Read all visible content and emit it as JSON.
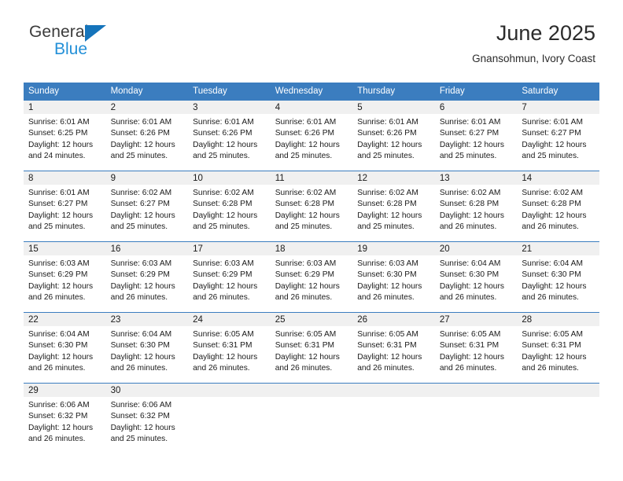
{
  "logo": {
    "primary_text": "General",
    "secondary_text": "Blue",
    "primary_color": "#3b3b3b",
    "secondary_color": "#2390d8",
    "accent_color": "#1574bb"
  },
  "header": {
    "title": "June 2025",
    "subtitle": "Gnansohmun, Ivory Coast"
  },
  "theme": {
    "header_bg": "#3b7dbf",
    "header_text": "#ffffff",
    "daynum_bg": "#f0f0f0",
    "cell_bg": "#ffffff",
    "grid_line": "#3b7dbf"
  },
  "weekday_headers": [
    "Sunday",
    "Monday",
    "Tuesday",
    "Wednesday",
    "Thursday",
    "Friday",
    "Saturday"
  ],
  "weeks": [
    [
      {
        "day": "1",
        "sunrise": "Sunrise: 6:01 AM",
        "sunset": "Sunset: 6:25 PM",
        "daylight_1": "Daylight: 12 hours",
        "daylight_2": "and 24 minutes."
      },
      {
        "day": "2",
        "sunrise": "Sunrise: 6:01 AM",
        "sunset": "Sunset: 6:26 PM",
        "daylight_1": "Daylight: 12 hours",
        "daylight_2": "and 25 minutes."
      },
      {
        "day": "3",
        "sunrise": "Sunrise: 6:01 AM",
        "sunset": "Sunset: 6:26 PM",
        "daylight_1": "Daylight: 12 hours",
        "daylight_2": "and 25 minutes."
      },
      {
        "day": "4",
        "sunrise": "Sunrise: 6:01 AM",
        "sunset": "Sunset: 6:26 PM",
        "daylight_1": "Daylight: 12 hours",
        "daylight_2": "and 25 minutes."
      },
      {
        "day": "5",
        "sunrise": "Sunrise: 6:01 AM",
        "sunset": "Sunset: 6:26 PM",
        "daylight_1": "Daylight: 12 hours",
        "daylight_2": "and 25 minutes."
      },
      {
        "day": "6",
        "sunrise": "Sunrise: 6:01 AM",
        "sunset": "Sunset: 6:27 PM",
        "daylight_1": "Daylight: 12 hours",
        "daylight_2": "and 25 minutes."
      },
      {
        "day": "7",
        "sunrise": "Sunrise: 6:01 AM",
        "sunset": "Sunset: 6:27 PM",
        "daylight_1": "Daylight: 12 hours",
        "daylight_2": "and 25 minutes."
      }
    ],
    [
      {
        "day": "8",
        "sunrise": "Sunrise: 6:01 AM",
        "sunset": "Sunset: 6:27 PM",
        "daylight_1": "Daylight: 12 hours",
        "daylight_2": "and 25 minutes."
      },
      {
        "day": "9",
        "sunrise": "Sunrise: 6:02 AM",
        "sunset": "Sunset: 6:27 PM",
        "daylight_1": "Daylight: 12 hours",
        "daylight_2": "and 25 minutes."
      },
      {
        "day": "10",
        "sunrise": "Sunrise: 6:02 AM",
        "sunset": "Sunset: 6:28 PM",
        "daylight_1": "Daylight: 12 hours",
        "daylight_2": "and 25 minutes."
      },
      {
        "day": "11",
        "sunrise": "Sunrise: 6:02 AM",
        "sunset": "Sunset: 6:28 PM",
        "daylight_1": "Daylight: 12 hours",
        "daylight_2": "and 25 minutes."
      },
      {
        "day": "12",
        "sunrise": "Sunrise: 6:02 AM",
        "sunset": "Sunset: 6:28 PM",
        "daylight_1": "Daylight: 12 hours",
        "daylight_2": "and 25 minutes."
      },
      {
        "day": "13",
        "sunrise": "Sunrise: 6:02 AM",
        "sunset": "Sunset: 6:28 PM",
        "daylight_1": "Daylight: 12 hours",
        "daylight_2": "and 26 minutes."
      },
      {
        "day": "14",
        "sunrise": "Sunrise: 6:02 AM",
        "sunset": "Sunset: 6:28 PM",
        "daylight_1": "Daylight: 12 hours",
        "daylight_2": "and 26 minutes."
      }
    ],
    [
      {
        "day": "15",
        "sunrise": "Sunrise: 6:03 AM",
        "sunset": "Sunset: 6:29 PM",
        "daylight_1": "Daylight: 12 hours",
        "daylight_2": "and 26 minutes."
      },
      {
        "day": "16",
        "sunrise": "Sunrise: 6:03 AM",
        "sunset": "Sunset: 6:29 PM",
        "daylight_1": "Daylight: 12 hours",
        "daylight_2": "and 26 minutes."
      },
      {
        "day": "17",
        "sunrise": "Sunrise: 6:03 AM",
        "sunset": "Sunset: 6:29 PM",
        "daylight_1": "Daylight: 12 hours",
        "daylight_2": "and 26 minutes."
      },
      {
        "day": "18",
        "sunrise": "Sunrise: 6:03 AM",
        "sunset": "Sunset: 6:29 PM",
        "daylight_1": "Daylight: 12 hours",
        "daylight_2": "and 26 minutes."
      },
      {
        "day": "19",
        "sunrise": "Sunrise: 6:03 AM",
        "sunset": "Sunset: 6:30 PM",
        "daylight_1": "Daylight: 12 hours",
        "daylight_2": "and 26 minutes."
      },
      {
        "day": "20",
        "sunrise": "Sunrise: 6:04 AM",
        "sunset": "Sunset: 6:30 PM",
        "daylight_1": "Daylight: 12 hours",
        "daylight_2": "and 26 minutes."
      },
      {
        "day": "21",
        "sunrise": "Sunrise: 6:04 AM",
        "sunset": "Sunset: 6:30 PM",
        "daylight_1": "Daylight: 12 hours",
        "daylight_2": "and 26 minutes."
      }
    ],
    [
      {
        "day": "22",
        "sunrise": "Sunrise: 6:04 AM",
        "sunset": "Sunset: 6:30 PM",
        "daylight_1": "Daylight: 12 hours",
        "daylight_2": "and 26 minutes."
      },
      {
        "day": "23",
        "sunrise": "Sunrise: 6:04 AM",
        "sunset": "Sunset: 6:30 PM",
        "daylight_1": "Daylight: 12 hours",
        "daylight_2": "and 26 minutes."
      },
      {
        "day": "24",
        "sunrise": "Sunrise: 6:05 AM",
        "sunset": "Sunset: 6:31 PM",
        "daylight_1": "Daylight: 12 hours",
        "daylight_2": "and 26 minutes."
      },
      {
        "day": "25",
        "sunrise": "Sunrise: 6:05 AM",
        "sunset": "Sunset: 6:31 PM",
        "daylight_1": "Daylight: 12 hours",
        "daylight_2": "and 26 minutes."
      },
      {
        "day": "26",
        "sunrise": "Sunrise: 6:05 AM",
        "sunset": "Sunset: 6:31 PM",
        "daylight_1": "Daylight: 12 hours",
        "daylight_2": "and 26 minutes."
      },
      {
        "day": "27",
        "sunrise": "Sunrise: 6:05 AM",
        "sunset": "Sunset: 6:31 PM",
        "daylight_1": "Daylight: 12 hours",
        "daylight_2": "and 26 minutes."
      },
      {
        "day": "28",
        "sunrise": "Sunrise: 6:05 AM",
        "sunset": "Sunset: 6:31 PM",
        "daylight_1": "Daylight: 12 hours",
        "daylight_2": "and 26 minutes."
      }
    ],
    [
      {
        "day": "29",
        "sunrise": "Sunrise: 6:06 AM",
        "sunset": "Sunset: 6:32 PM",
        "daylight_1": "Daylight: 12 hours",
        "daylight_2": "and 26 minutes."
      },
      {
        "day": "30",
        "sunrise": "Sunrise: 6:06 AM",
        "sunset": "Sunset: 6:32 PM",
        "daylight_1": "Daylight: 12 hours",
        "daylight_2": "and 25 minutes."
      },
      {
        "day": "",
        "sunrise": "",
        "sunset": "",
        "daylight_1": "",
        "daylight_2": ""
      },
      {
        "day": "",
        "sunrise": "",
        "sunset": "",
        "daylight_1": "",
        "daylight_2": ""
      },
      {
        "day": "",
        "sunrise": "",
        "sunset": "",
        "daylight_1": "",
        "daylight_2": ""
      },
      {
        "day": "",
        "sunrise": "",
        "sunset": "",
        "daylight_1": "",
        "daylight_2": ""
      },
      {
        "day": "",
        "sunrise": "",
        "sunset": "",
        "daylight_1": "",
        "daylight_2": ""
      }
    ]
  ]
}
